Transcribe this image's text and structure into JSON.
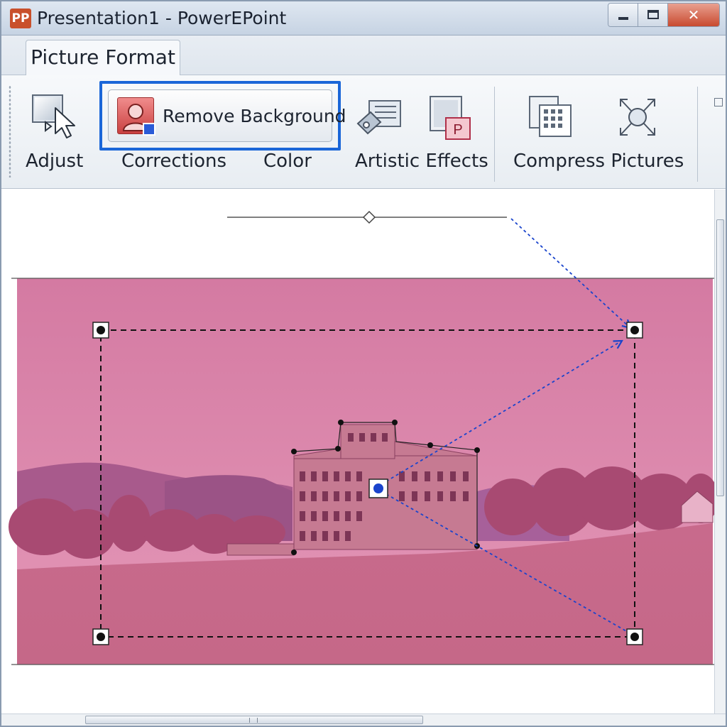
{
  "window": {
    "title": "Presentation1 - PowerEPoint",
    "app_icon_letters": "PP",
    "close_glyph": "✕"
  },
  "ribbon": {
    "active_tab": "Picture Format",
    "remove_background_label": "Remove Background",
    "groups": {
      "adjust": "Adjust",
      "corrections": "Corrections",
      "color": "Color",
      "artistic_effects": "Artistic Effects",
      "compress_pictures": "Compress Pictures"
    },
    "icons": {
      "adjust": "cursor-icon",
      "remove_background": "person-icon",
      "artistic_effects": "artistic-effects-icon",
      "picture_p": "picture-p-icon",
      "compress": "compress-grid-icon",
      "transform": "arrows-expand-icon"
    },
    "highlight_color": "#1a66d8"
  },
  "canvas": {
    "image_tint": "#d07aa0",
    "handle_color": "#000000",
    "arrow_color": "#1a44cc"
  }
}
